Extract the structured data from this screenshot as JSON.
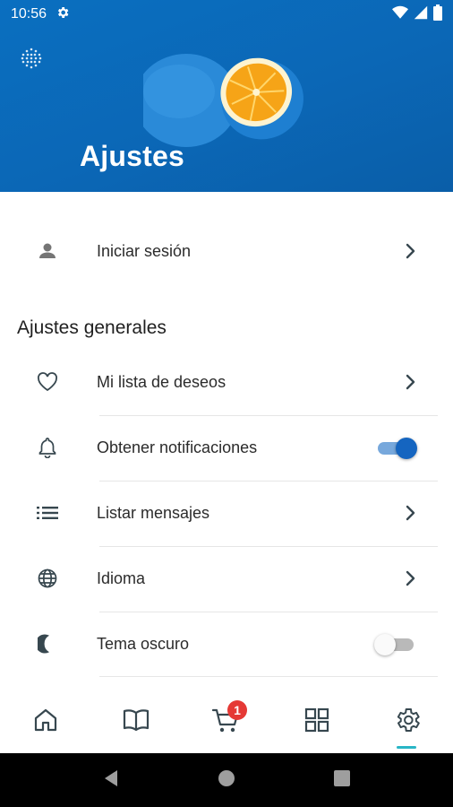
{
  "status_bar": {
    "time": "10:56"
  },
  "header": {
    "title": "Ajustes"
  },
  "login": {
    "label": "Iniciar sesión"
  },
  "general": {
    "title": "Ajustes generales",
    "items": [
      {
        "label": "Mi lista de deseos",
        "icon": "heart-icon",
        "trailing": "chevron"
      },
      {
        "label": "Obtener notificaciones",
        "icon": "bell-icon",
        "trailing": "toggle",
        "enabled": true
      },
      {
        "label": "Listar mensajes",
        "icon": "list-icon",
        "trailing": "chevron"
      },
      {
        "label": "Idioma",
        "icon": "globe-icon",
        "trailing": "chevron"
      },
      {
        "label": "Tema oscuro",
        "icon": "moon-icon",
        "trailing": "toggle",
        "enabled": false
      }
    ]
  },
  "bottom_nav": {
    "items": [
      "home-icon",
      "book-icon",
      "cart-icon",
      "grid-icon",
      "settings-icon"
    ],
    "cart_badge": "1",
    "active": "settings-icon"
  },
  "colors": {
    "header_blue": "#0b67b6",
    "accent": "#1565c0",
    "badge": "#e53935",
    "active_indicator": "#29b6c6",
    "icon": "#37474f"
  }
}
